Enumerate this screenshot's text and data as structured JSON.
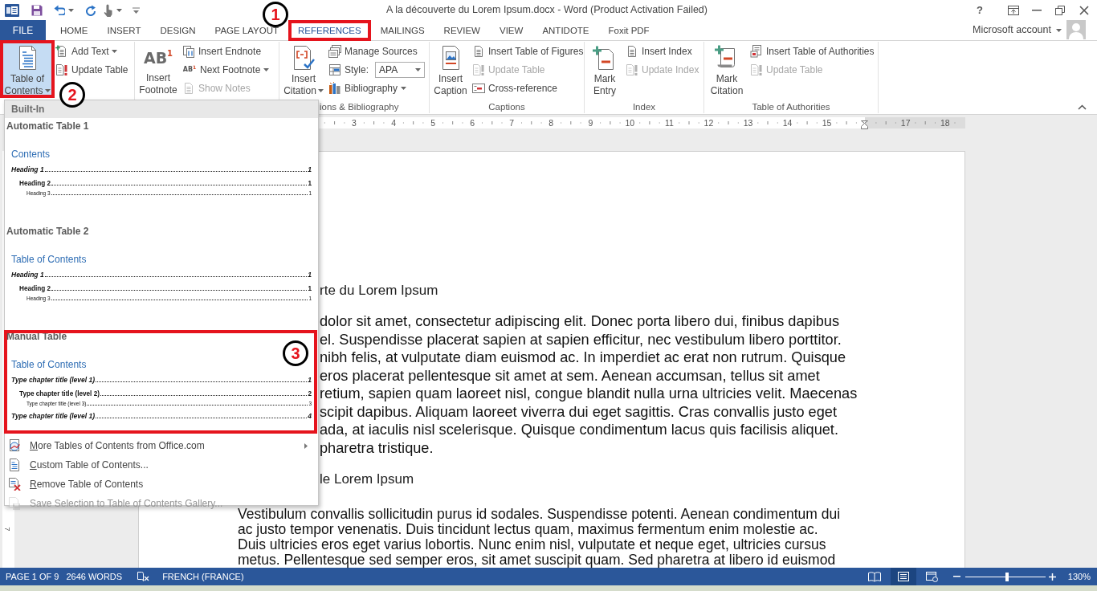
{
  "title_bar": {
    "title": "A la découverte du Lorem Ipsum.docx - Word (Product Activation Failed)",
    "help": "?"
  },
  "tabs": [
    {
      "label": "FILE",
      "kind": "file",
      "selected": false
    },
    {
      "label": "HOME",
      "kind": "tab",
      "selected": false
    },
    {
      "label": "INSERT",
      "kind": "tab",
      "selected": false
    },
    {
      "label": "DESIGN",
      "kind": "tab",
      "selected": false
    },
    {
      "label": "PAGE LAYOUT",
      "kind": "tab",
      "selected": false
    },
    {
      "label": "REFERENCES",
      "kind": "tab",
      "selected": true,
      "callout": "1"
    },
    {
      "label": "MAILINGS",
      "kind": "tab",
      "selected": false
    },
    {
      "label": "REVIEW",
      "kind": "tab",
      "selected": false
    },
    {
      "label": "VIEW",
      "kind": "tab",
      "selected": false
    },
    {
      "label": "ANTIDOTE",
      "kind": "tab",
      "selected": false
    },
    {
      "label": "Foxit PDF",
      "kind": "tab",
      "selected": false
    }
  ],
  "account": {
    "label": "Microsoft account"
  },
  "ribbon": {
    "groups": [
      {
        "large": {
          "label": "Table of Contents",
          "dropdown": true,
          "pressed": true,
          "callout": "2"
        },
        "small": [
          {
            "kind": "button",
            "label": "Add Text",
            "dropdown": true,
            "disabled": false
          },
          {
            "kind": "button",
            "label": "Update Table",
            "dropdown": false,
            "disabled": false
          }
        ]
      },
      {
        "large": {
          "label": "Insert Footnote",
          "glyph": "AB$^{1}$",
          "dropdown": false,
          "pressed": false
        },
        "small": [
          {
            "kind": "button",
            "label": "Insert Endnote",
            "dropdown": false,
            "disabled": false
          },
          {
            "kind": "button",
            "label": "Next Footnote",
            "glyph": "AB$^{1}$",
            "dropdown": true,
            "disabled": false
          },
          {
            "kind": "button",
            "label": "Show Notes",
            "dropdown": false,
            "disabled": true
          }
        ]
      },
      {
        "label": "ions & Bibliography",
        "clipped": true,
        "large": {
          "label": "Insert Citation",
          "dropdown": true,
          "pressed": false
        },
        "small": [
          {
            "kind": "button",
            "label": "Manage Sources",
            "dropdown": false,
            "disabled": false
          },
          {
            "kind": "select",
            "label": "Style:",
            "value": "APA"
          },
          {
            "kind": "button",
            "label": "Bibliography",
            "dropdown": true,
            "disabled": false
          }
        ]
      },
      {
        "label": "Captions",
        "clipped": false,
        "large": {
          "label": "Insert Caption",
          "dropdown": false,
          "pressed": false
        },
        "small": [
          {
            "kind": "button",
            "label": "Insert Table of Figures",
            "dropdown": false,
            "disabled": false
          },
          {
            "kind": "button",
            "label": "Update Table",
            "dropdown": false,
            "disabled": true
          },
          {
            "kind": "button",
            "label": "Cross-reference",
            "dropdown": false,
            "disabled": false
          }
        ]
      },
      {
        "label": "Index",
        "clipped": false,
        "large": {
          "label": "Mark Entry",
          "dropdown": false,
          "pressed": false
        },
        "small": [
          {
            "kind": "button",
            "label": "Insert Index",
            "dropdown": false,
            "disabled": false
          },
          {
            "kind": "button",
            "label": "Update Index",
            "dropdown": false,
            "disabled": true
          }
        ]
      },
      {
        "label": "Table of Authorities",
        "clipped": false,
        "large": {
          "label": "Mark Citation",
          "dropdown": false,
          "pressed": false
        },
        "small": [
          {
            "kind": "button",
            "label": "Insert Table of Authorities",
            "dropdown": false,
            "disabled": false
          },
          {
            "kind": "button",
            "label": "Update Table",
            "dropdown": false,
            "disabled": true
          }
        ]
      }
    ]
  },
  "ruler": {
    "numbers": [
      "3",
      "4",
      "5",
      "6",
      "7",
      "8",
      "9",
      "10",
      "11",
      "12",
      "13",
      "14",
      "15",
      "17",
      "18"
    ]
  },
  "vertical_ruler": {
    "numbers": [
      "7"
    ]
  },
  "toc_menu": {
    "section": "Built-In",
    "gallery": [
      {
        "title": "Automatic Table 1",
        "heading": "Contents",
        "entries": [
          {
            "text": "Heading 1",
            "page": "1",
            "children": [
              {
                "text": "Heading 2",
                "page": "1",
                "children": [
                  {
                    "text": "Heading 3",
                    "page": "1"
                  }
                ]
              }
            ]
          }
        ]
      },
      {
        "title": "Automatic Table 2",
        "heading": "Table of Contents",
        "entries": [
          {
            "text": "Heading 1",
            "page": "1",
            "children": [
              {
                "text": "Heading 2",
                "page": "1",
                "children": [
                  {
                    "text": "Heading 3",
                    "page": "1"
                  }
                ]
              }
            ]
          }
        ]
      },
      {
        "title": "Manual Table",
        "heading": "Table of Contents",
        "callout": "3",
        "entries": [
          {
            "text": "Type chapter title (level 1)",
            "page": "1",
            "children": [
              {
                "text": "Type chapter title (level 2)",
                "page": "2",
                "children": [
                  {
                    "text": "Type chapter title (level 3)",
                    "page": "3"
                  }
                ]
              }
            ]
          },
          {
            "text": "Type chapter title (level 1)",
            "page": "4"
          }
        ]
      }
    ],
    "items": [
      {
        "label": "More Tables of Contents from Office.com",
        "submenu": true,
        "disabled": false
      },
      {
        "label": "Custom Table of Contents...",
        "submenu": false,
        "disabled": false
      },
      {
        "label": "Remove Table of Contents",
        "submenu": false,
        "disabled": false
      },
      {
        "label": "Save Selection to Table of Contents Gallery...",
        "submenu": false,
        "disabled": true
      }
    ]
  },
  "document": {
    "blocks": [
      {
        "kind": "heading",
        "clipped": true,
        "text": "rte du Lorem Ipsum"
      },
      {
        "kind": "paragraph",
        "clipped": true,
        "lines": [
          "dolor sit amet, consectetur adipiscing elit. Donec porta libero dui, finibus dapibus",
          "el. Suspendisse placerat sapien at sapien efficitur, nec vestibulum libero porttitor.",
          "nibh felis, at vulputate diam euismod ac. In imperdiet ac erat non rutrum. Quisque",
          "eros placerat pellentesque sit amet at sem. Aenean accumsan, tellus sit amet",
          "retium, sapien quam laoreet nisl, congue blandit nulla urna ultricies velit. Maecenas",
          "scipit dapibus. Aliquam laoreet viverra dui eget sagittis. Cras convallis justo eget",
          "ada, at iaculis nisl scelerisque. Quisque condimentum lacus quis facilisis aliquet.",
          "pharetra tristique."
        ]
      },
      {
        "kind": "heading",
        "clipped": true,
        "text": "le Lorem Ipsum"
      },
      {
        "kind": "paragraph",
        "clipped": false,
        "lines": [
          "Vestibulum convallis sollicitudin purus id sodales. Suspendisse potenti. Aenean condimentum dui",
          "ac justo tempor venenatis. Duis tincidunt lectus quam, maximus fermentum enim molestie ac.",
          "Duis ultricies eros eget varius lobortis. Nunc enim nisl, vulputate et neque eget, ultricies cursus",
          "metus. Pellentesque sed semper eros, sit amet suscipit quam. Sed pharetra at libero id euismod"
        ]
      }
    ]
  },
  "status_bar": {
    "page": "PAGE 1 OF 9",
    "words": "2646 WORDS",
    "language": "FRENCH (FRANCE)",
    "views": [
      {
        "selected": false
      },
      {
        "selected": true
      },
      {
        "selected": false
      }
    ],
    "zoom": {
      "level": 0.52,
      "reading": "130%"
    }
  }
}
